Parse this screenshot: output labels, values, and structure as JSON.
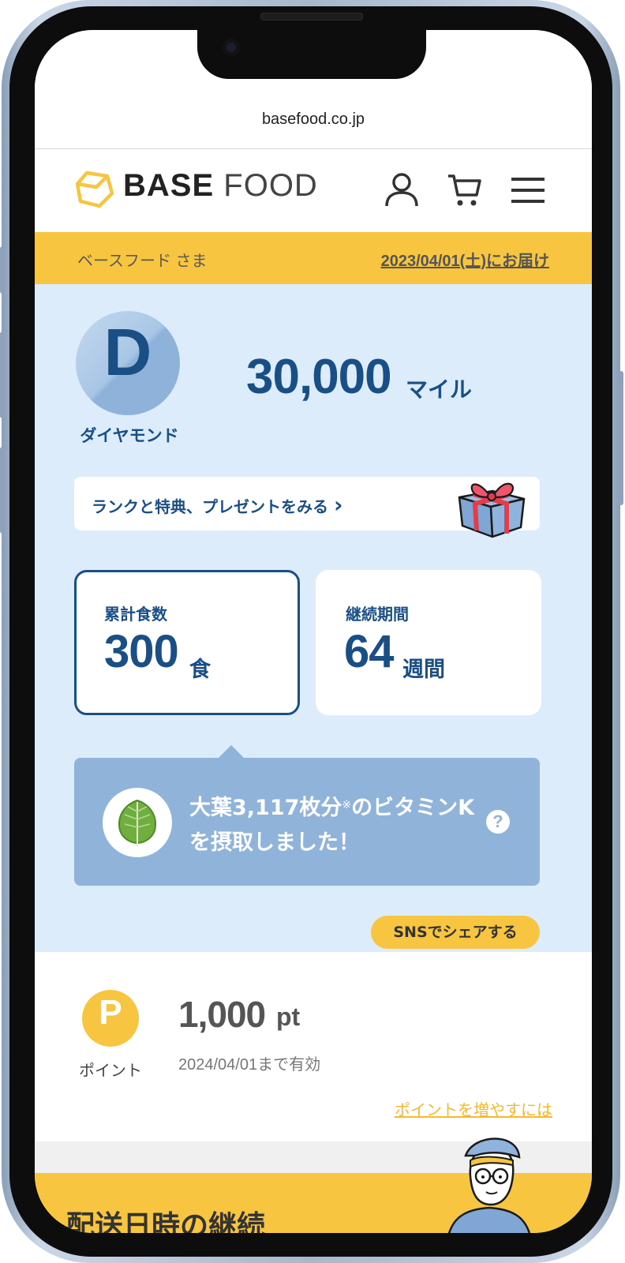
{
  "browser": {
    "url": "basefood.co.jp"
  },
  "header": {
    "logo_bold": "BASE",
    "logo_light": "FOOD"
  },
  "delivery": {
    "customer": "ベースフード さま",
    "date": "2023/04/01(土)にお届け"
  },
  "rank": {
    "letter": "D",
    "name": "ダイヤモンド",
    "miles_value": "30,000",
    "miles_unit": "マイル",
    "benefits_link": "ランクと特典、プレゼントをみる",
    "benefits_chevron": "›"
  },
  "stats": {
    "meals_label": "累計食数",
    "meals_value": "300",
    "meals_unit": "食",
    "weeks_label": "継続期間",
    "weeks_value": "64",
    "weeks_unit": "週間"
  },
  "vitamin": {
    "line_before": "大葉3,117枚分",
    "mark": "※",
    "line_after": "のビタミンKを摂取しました！",
    "help": "?"
  },
  "share": {
    "label": "SNSでシェアする"
  },
  "points": {
    "letter": "P",
    "label": "ポイント",
    "value": "1,000",
    "unit": "pt",
    "expiry": "2024/04/01まで有効",
    "link": "ポイントを増やすには"
  },
  "bottom": {
    "heading": "配送日時の継続"
  },
  "colors": {
    "brand_yellow": "#f7c53f",
    "navy": "#1a4f86",
    "panel_blue": "#dcecfb",
    "vitamin_blue": "#8fb3d9"
  },
  "icons": [
    "logo-hexagon-icon",
    "user-icon",
    "cart-icon",
    "menu-icon",
    "gift-icon",
    "leaf-icon",
    "help-icon",
    "mascot-illustration"
  ]
}
